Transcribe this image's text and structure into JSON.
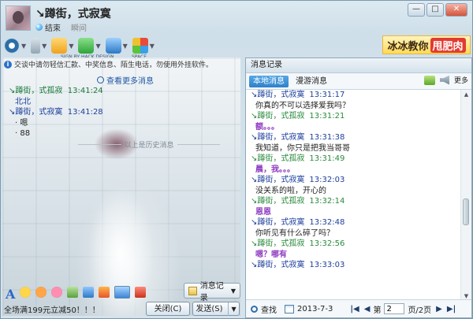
{
  "window": {
    "contact_name": "↘蹲街，式寂寞",
    "status_text": "结束",
    "status_text2": "瞬间",
    "min_label": "—",
    "max_label": "□",
    "close_label": "✕"
  },
  "toolbar": {
    "label_left": "SIGN BY HACK DESIGN",
    "label_right": "SPACE"
  },
  "banner": {
    "text": "冰冰教你",
    "highlight": "甩肥肉"
  },
  "chat": {
    "notice": "交谈中请勿轻信汇款、中奖信息、陌生电话，勿使用外挂软件。",
    "more_messages": "查看更多消息",
    "lines": [
      {
        "name": "↘蹲街，式孤寂",
        "time": "13:41:24",
        "msg": "北北"
      },
      {
        "name": "↘蹲街，式寂寞",
        "time": "13:41:28",
        "msg": "嗯"
      },
      {
        "name": "",
        "time": "",
        "msg": "88"
      }
    ],
    "history_divider": "以上是历史消息",
    "history_button": "消息记录",
    "font_icon_text": "A"
  },
  "bottom": {
    "promo": "全场满199元立减50！！！",
    "close_button": "关闭(C)",
    "send_button": "发送(S)"
  },
  "history": {
    "title": "消息记录",
    "tabs": [
      "本地消息",
      "漫游消息"
    ],
    "more": "更多",
    "entries": [
      {
        "name": "↘蹲街，式寂寞",
        "time": "13:31:17",
        "color": "blue",
        "msg": "你真的不可以选择爱我吗？",
        "msg_style": "normal"
      },
      {
        "name": "↘蹲街，式孤寂",
        "time": "13:31:21",
        "color": "green",
        "msg": "额。。。",
        "msg_style": "purple"
      },
      {
        "name": "↘蹲街，式寂寞",
        "time": "13:31:38",
        "color": "blue",
        "msg": "我知道，你只是把我当哥哥",
        "msg_style": "normal"
      },
      {
        "name": "↘蹲街，式孤寂",
        "time": "13:31:49",
        "color": "green",
        "msg": "晨，我。。。",
        "msg_style": "purple"
      },
      {
        "name": "↘蹲街，式寂寞",
        "time": "13:32:03",
        "color": "blue",
        "msg": "没关系的啦，开心的",
        "msg_style": "normal"
      },
      {
        "name": "↘蹲街，式孤寂",
        "time": "13:32:14",
        "color": "green",
        "msg": "恩恩",
        "msg_style": "purple"
      },
      {
        "name": "↘蹲街，式寂寞",
        "time": "13:32:48",
        "color": "blue",
        "msg": "你听见有什么碎了吗？",
        "msg_style": "normal"
      },
      {
        "name": "↘蹲街，式孤寂",
        "time": "13:32:56",
        "color": "green",
        "msg": "嗯？哪有",
        "msg_style": "purple"
      },
      {
        "name": "↘蹲街，式寂寞",
        "time": "13:33:03",
        "color": "blue",
        "msg": "",
        "msg_style": "normal"
      }
    ],
    "search_label": "查找",
    "date": "2013-7-3",
    "page_prefix": "第",
    "page_value": "2",
    "page_suffix": "页/2页"
  }
}
